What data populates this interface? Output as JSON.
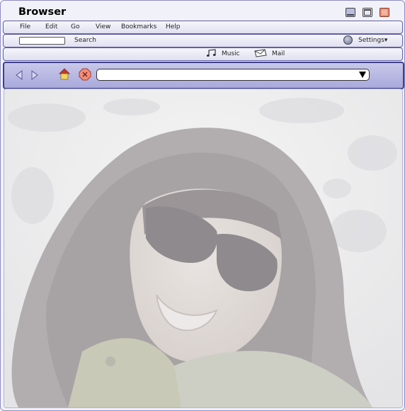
{
  "window": {
    "title": "Browser"
  },
  "menu": {
    "items": [
      {
        "id": "file",
        "label": "File"
      },
      {
        "id": "edit",
        "label": "Edit"
      },
      {
        "id": "go",
        "label": "Go"
      },
      {
        "id": "view",
        "label": "View"
      },
      {
        "id": "bookmarks",
        "label": "Bookmarks"
      },
      {
        "id": "help",
        "label": "Help"
      }
    ]
  },
  "search": {
    "value": "",
    "label": "Search"
  },
  "settings": {
    "label": "Settings▾",
    "icon": "settings-icon"
  },
  "links": {
    "music": {
      "label": "Music",
      "icon": "music-note-icon"
    },
    "mail": {
      "label": "Mail",
      "icon": "envelope-icon"
    }
  },
  "nav": {
    "back_icon": "back-arrow-icon",
    "forward_icon": "forward-arrow-icon",
    "home_icon": "home-icon",
    "stop_icon": "stop-icon",
    "address": {
      "value": ""
    }
  },
  "content": {
    "image": "portrait photo: smiling woman with dark sunglasses and long dark hair against snowy background (faded)"
  },
  "colors": {
    "accent": "#3f3f8c",
    "bar": "#e6e6f5",
    "navbar": "#b4b4e2",
    "close": "#ef8f7a"
  }
}
